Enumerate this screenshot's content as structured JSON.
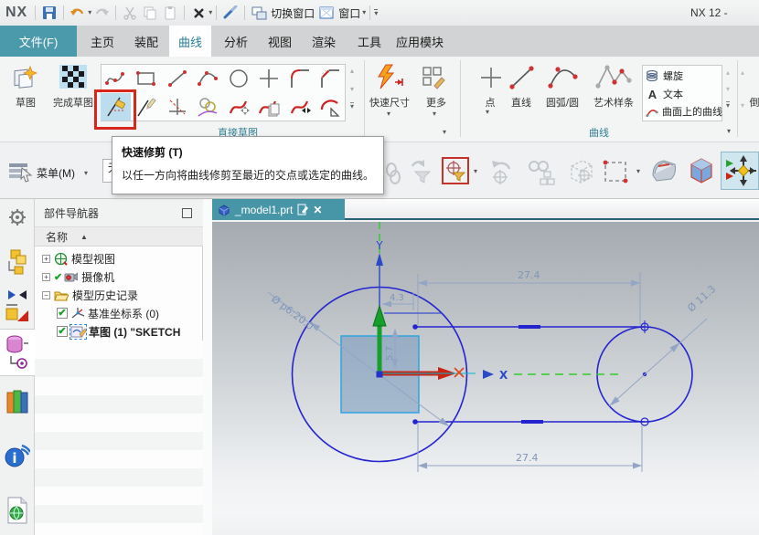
{
  "titlebar": {
    "logo": "NX",
    "switch_window": "切换窗口",
    "window": "窗口",
    "app_title": "NX 12 -"
  },
  "tabbar": {
    "file": "文件(F)",
    "tabs": [
      "主页",
      "装配",
      "曲线",
      "分析",
      "视图",
      "渲染",
      "工具",
      "应用模块"
    ]
  },
  "ribbon": {
    "sketch": "草图",
    "finish_sketch": "完成草图",
    "group_direct_sketch": "直接草图",
    "quick_dim": "快速尺寸",
    "more": "更多",
    "point": "点",
    "line": "直线",
    "arc": "圆弧/圆",
    "art_spline": "艺术样条",
    "helix": "螺旋",
    "text": "文本",
    "curve_on_surface": "曲面上的曲线",
    "group_curve": "曲线",
    "clipped_right": "倒"
  },
  "tooltip": {
    "title": "快速修剪 (T)",
    "desc": "以任一方向将曲线修剪至最近的交点或选定的曲线。"
  },
  "toolbar": {
    "menu": "菜单(M)",
    "filter_hidden": "无"
  },
  "navigator": {
    "title": "部件导航器",
    "col_name": "名称",
    "model_view": "模型视图",
    "camera": "摄像机",
    "history": "模型历史记录",
    "datum": "基准坐标系 (0)",
    "sketch_item": "草图 (1) \"SKETCH"
  },
  "canvas": {
    "doc_tab": "_model1.prt",
    "y_label": "Y",
    "x_label": "X",
    "dim_top": "27.4",
    "dim_bottom": "27.4",
    "dim_width": "4.3",
    "dim_height": "5.7",
    "dia_big": "Ø p6:20.0",
    "dia_small": "Ø 11.3"
  },
  "colors": {
    "accent": "#4a9aac",
    "active_tab_text": "#2a7f93",
    "annotation_red": "#d7271d",
    "sketch_blue": "#2424cf",
    "dim_slate": "#8095ba",
    "axis_green": "#15a02a",
    "axis_red": "#cc2314",
    "select_fill": "#6e8cb9"
  }
}
